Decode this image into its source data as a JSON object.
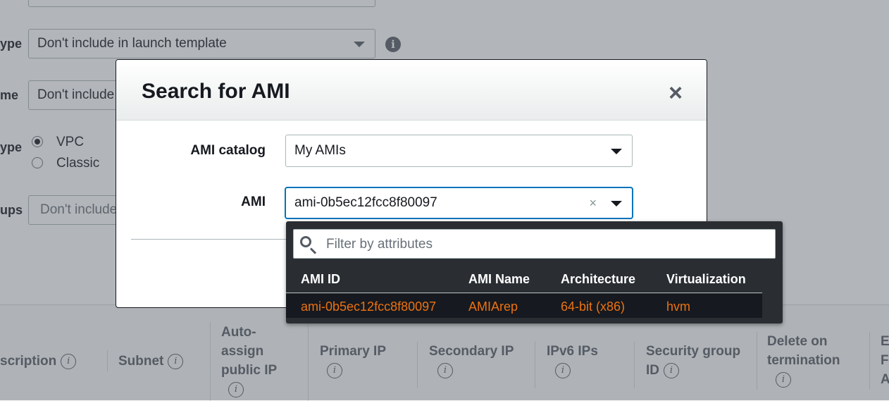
{
  "background_form": {
    "rows": [
      {
        "label": "ype",
        "value": "Don't include in launch template"
      },
      {
        "label": "me",
        "value": "Don't include"
      },
      {
        "label": "ype",
        "radios": [
          "VPC",
          "Classic"
        ],
        "selected": "VPC"
      },
      {
        "label": "ups",
        "value": "Don't include"
      }
    ],
    "info_icon": "i"
  },
  "network_table": {
    "headers": [
      "scription",
      "Subnet",
      "Auto-assign public IP",
      "Primary IP",
      "Secondary IP",
      "IPv6 IPs",
      "Security group ID",
      "Delete on termination",
      "E F A"
    ],
    "info_icon": "i"
  },
  "modal": {
    "title": "Search for AMI",
    "close_icon": "×",
    "catalog_label": "AMI catalog",
    "catalog_value": "My AMIs",
    "ami_label": "AMI",
    "ami_value": "ami-0b5ec12fcc8f80097",
    "clear_icon": "×"
  },
  "ami_dropdown": {
    "filter_placeholder": "Filter by attributes",
    "columns": [
      "AMI ID",
      "AMI Name",
      "Architecture",
      "Virtualization"
    ],
    "rows": [
      {
        "id": "ami-0b5ec12fcc8f80097",
        "name": "AMIArep",
        "architecture": "64-bit (x86)",
        "virtualization": "hvm"
      }
    ],
    "highlight_color": "#ec7211"
  }
}
